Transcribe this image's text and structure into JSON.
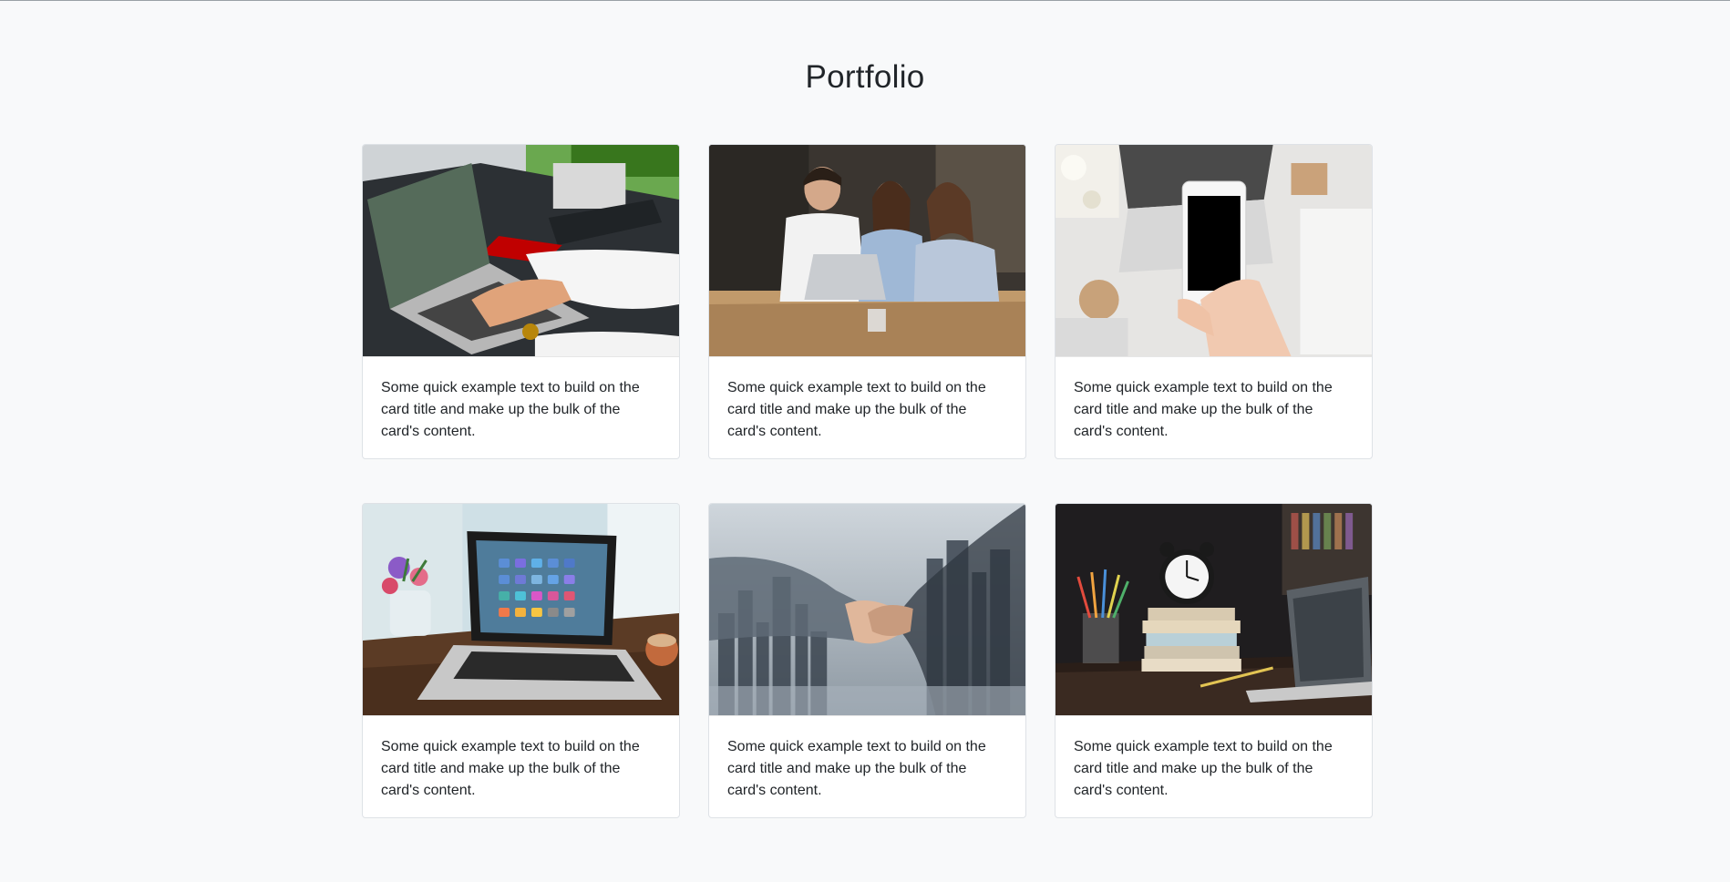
{
  "page": {
    "title": "Portfolio"
  },
  "cards": [
    {
      "image": "laptop-typing-photo",
      "text": "Some quick example text to build on the card title and make up the bulk of the card's content."
    },
    {
      "image": "team-meeting-photo",
      "text": "Some quick example text to build on the card title and make up the bulk of the card's content."
    },
    {
      "image": "smartphone-hand-photo",
      "text": "Some quick example text to build on the card title and make up the bulk of the card's content."
    },
    {
      "image": "laptop-apps-photo",
      "text": "Some quick example text to build on the card title and make up the bulk of the card's content."
    },
    {
      "image": "handshake-city-photo",
      "text": "Some quick example text to build on the card title and make up the bulk of the card's content."
    },
    {
      "image": "desk-clock-books-photo",
      "text": "Some quick example text to build on the card title and make up the bulk of the card's content."
    }
  ],
  "colors": {
    "background": "#f8f9fa",
    "card": "#ffffff",
    "border": "#dee2e6",
    "text": "#212529"
  }
}
